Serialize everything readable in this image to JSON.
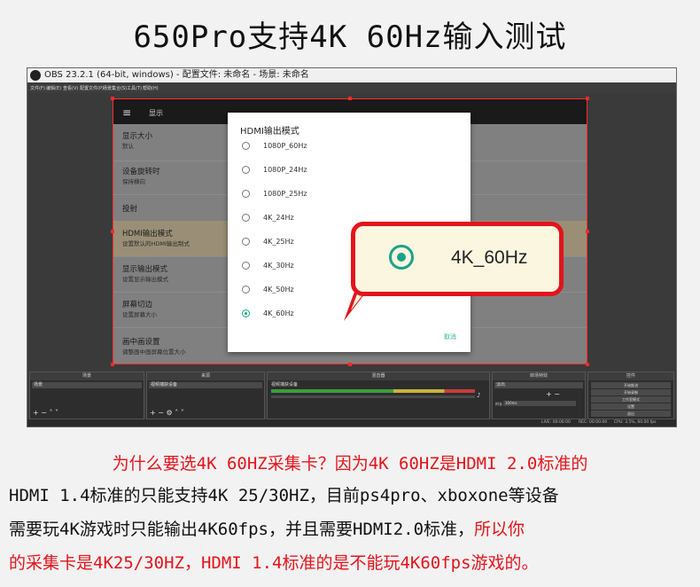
{
  "page_title": "650Pro支持4K 60Hz输入测试",
  "obs": {
    "window_title": "OBS 23.2.1 (64-bit, windows) - 配置文件: 未命名 - 场景: 未命名",
    "menu": [
      "文件(F)",
      "编辑(E)",
      "查看(V)",
      "配置文件(P)",
      "场景集合(S)",
      "工具(T)",
      "帮助(H)"
    ],
    "app_header_title": "显示",
    "settings": [
      {
        "title": "显示大小",
        "subtitle": "默认"
      },
      {
        "title": "设备旋转时",
        "subtitle": "保持横向"
      },
      {
        "title": "投射",
        "subtitle": ""
      },
      {
        "title": "HDMI输出模式",
        "subtitle": "设置默认的HDMI输出制式"
      },
      {
        "title": "显示输出模式",
        "subtitle": "设置显示输出模式"
      },
      {
        "title": "屏幕切边",
        "subtitle": "设置屏幕大小"
      },
      {
        "title": "画中画设置",
        "subtitle": "调整画中画屏幕位置大小"
      }
    ],
    "dialog": {
      "title": "HDMI输出模式",
      "options": [
        "1080P_60Hz",
        "1080P_24Hz",
        "1080P_25Hz",
        "4K_24Hz",
        "4K_25Hz",
        "4K_30Hz",
        "4K_50Hz",
        "4K_60Hz"
      ],
      "selected": "4K_60Hz",
      "cancel": "取消"
    },
    "docks": {
      "scenes": {
        "header": "场景",
        "item": "场景",
        "footer": "+ − ˄ ˅"
      },
      "sources": {
        "header": "来源",
        "item": "视频捕获设备",
        "footer": "+ − ⚙ ˄ ˅"
      },
      "mixer": {
        "header": "混音器",
        "item": "视频捕获设备"
      },
      "transitions": {
        "header": "转场特效",
        "item": "淡出",
        "duration_label": "时长",
        "duration": "300ms"
      },
      "controls": {
        "header": "控件",
        "buttons": [
          "开始推流",
          "开始录制",
          "工作室模式",
          "设置",
          "退出"
        ]
      }
    },
    "status": {
      "live": "LIVE: 00:00:00",
      "rec": "REC: 00:00:00",
      "cpu": "CPU: 3.5%, 60.00 fps"
    }
  },
  "callout": {
    "label": "4K_60Hz"
  },
  "paragraph": {
    "line1": "为什么要选4K 60HZ采集卡？因为4K 60HZ是HDMI 2.0标准的",
    "line2": "HDMI 1.4标准的只能支持4K 25/30HZ，目前ps4pro、xboxone等设备",
    "line3_black": "需要玩4K游戏时只能输出4K60fps，并且需要HDMI2.0标准，",
    "line3_red": "所以你",
    "line4": "的采集卡是4K25/30HZ，HDMI 1.4标准的是不能玩4K60fps游戏的。"
  },
  "colors": {
    "accent_red": "#e3141b",
    "radio_green": "#1aa38a",
    "selection_border": "#ff2a2a",
    "highlight_row": "#9a8f76"
  }
}
